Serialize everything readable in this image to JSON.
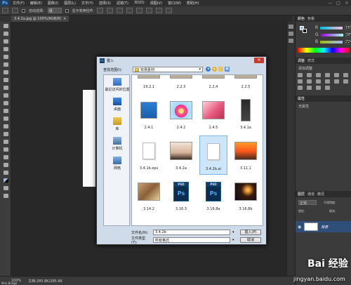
{
  "app": {
    "logo": "Ps",
    "menus": [
      "文件(F)",
      "编辑(E)",
      "图像(I)",
      "图层(L)",
      "文字(Y)",
      "选择(S)",
      "滤镜(T)",
      "3D(D)",
      "视图(V)",
      "窗口(W)",
      "帮助(H)"
    ],
    "window_controls": [
      "—",
      "□",
      "×"
    ]
  },
  "options_bar": {
    "auto_select_label": "自动选择:",
    "auto_select_value": "组",
    "transform_label": "显示变换控件"
  },
  "document_tab": {
    "title": "3.4.2a.jpg @ 100%(RGB/8)",
    "close": "×"
  },
  "status_bar": {
    "zoom": "100%",
    "doc_info": "文档:285.8K/285.8K",
    "mini_bridge": "Mini Bridge"
  },
  "right_panel": {
    "color_tabs": [
      "颜色",
      "色板"
    ],
    "rgb": [
      {
        "label": "R",
        "value": "161"
      },
      {
        "label": "G",
        "value": "187"
      },
      {
        "label": "B",
        "value": "224"
      }
    ],
    "adjust_tabs": [
      "调整",
      "样式"
    ],
    "adjust_title": "添加调整",
    "layer_props_tab": "属性",
    "layer_props_value": "无属性",
    "layers_tabs": [
      "图层",
      "通道",
      "路径"
    ],
    "blend_mode": "正常",
    "opacity_label": "不透明度:",
    "lock_label": "锁定:",
    "fill_label": "填充:",
    "layer_name": "背景"
  },
  "dialog": {
    "title": "置入",
    "close": "×",
    "look_in_label": "查找范围(I):",
    "look_in_value": "实例素材",
    "places": [
      {
        "label": "最近访问的位置",
        "icon": "recent-places-icon"
      },
      {
        "label": "桌面",
        "icon": "desktop-icon"
      },
      {
        "label": "库",
        "icon": "libraries-icon"
      },
      {
        "label": "计算机",
        "icon": "computer-icon"
      },
      {
        "label": "网络",
        "icon": "network-icon"
      }
    ],
    "files": [
      {
        "label": "19.2.1",
        "kind": "image-partial"
      },
      {
        "label": "2.2.3",
        "kind": "image-partial"
      },
      {
        "label": "2.2.4",
        "kind": "image-partial"
      },
      {
        "label": "2.2.5",
        "kind": "image-partial"
      },
      {
        "label": "2.4.1",
        "kind": "floppy"
      },
      {
        "label": "2.4.2",
        "kind": "flower"
      },
      {
        "label": "2.4.5",
        "kind": "lips"
      },
      {
        "label": "3.4.1a",
        "kind": "phone"
      },
      {
        "label": "3.4.1b.eps",
        "kind": "document"
      },
      {
        "label": "3.4.2a",
        "kind": "woman"
      },
      {
        "label": "3.4.2b.ai",
        "kind": "document",
        "selected": true
      },
      {
        "label": "3.11.1",
        "kind": "sunset"
      },
      {
        "label": "3.14.2",
        "kind": "collage"
      },
      {
        "label": "3.16.3",
        "kind": "psd"
      },
      {
        "label": "3.16.8a",
        "kind": "psd"
      },
      {
        "label": "3.16.8b",
        "kind": "night"
      }
    ],
    "psd_badge": "PSD",
    "psd_letters": "Ps",
    "filename_label": "文件名(N):",
    "filename_value": "3.4.2b",
    "filetype_label": "文件类型(T):",
    "filetype_value": "所有格式",
    "place_button": "置入(P)",
    "cancel_button": "取消"
  },
  "watermark": {
    "brand": "Bai 经验",
    "url": "jingyan.baidu.com"
  }
}
